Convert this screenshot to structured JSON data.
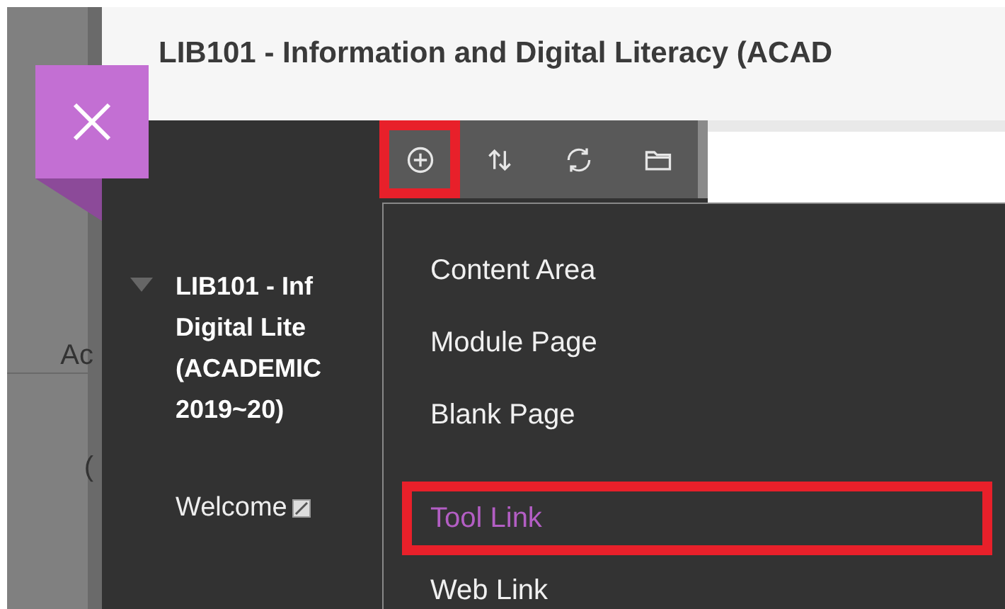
{
  "header": {
    "title": "LIB101 - Information and Digital Literacy (ACAD"
  },
  "background": {
    "side_labels": [
      "Ac",
      "("
    ]
  },
  "toolbar": {
    "buttons": [
      {
        "kind": "add",
        "highlighted": true
      },
      {
        "kind": "reorder",
        "highlighted": false
      },
      {
        "kind": "refresh",
        "highlighted": false
      },
      {
        "kind": "folder",
        "highlighted": false
      }
    ]
  },
  "sidebar": {
    "course": {
      "expanded": true,
      "title_lines": [
        "LIB101 - Inf",
        "Digital Lite",
        "(ACADEMIC",
        "2019~20)"
      ]
    },
    "items": [
      {
        "label": "Welcome"
      }
    ]
  },
  "menu": {
    "items": [
      {
        "label": "Content Area",
        "selected": false,
        "highlighted": false
      },
      {
        "label": "Module Page",
        "selected": false,
        "highlighted": false
      },
      {
        "label": "Blank Page",
        "selected": false,
        "highlighted": false
      },
      {
        "label": "Tool Link",
        "selected": true,
        "highlighted": true
      },
      {
        "label": "Web Link",
        "selected": false,
        "highlighted": false
      }
    ]
  }
}
